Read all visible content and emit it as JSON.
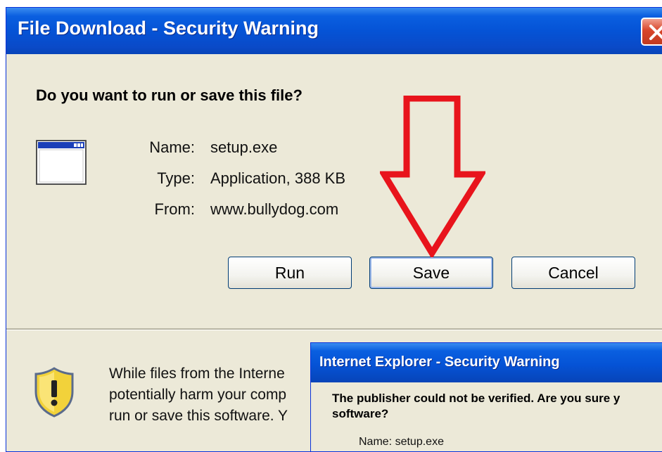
{
  "dialog": {
    "title": "File Download - Security Warning",
    "question": "Do you want to run or save this file?",
    "file": {
      "name_label": "Name:",
      "name_value": "setup.exe",
      "type_label": "Type:",
      "type_value": "Application, 388 KB",
      "from_label": "From:",
      "from_value": "www.bullydog.com"
    },
    "buttons": {
      "run": "Run",
      "save": "Save",
      "cancel": "Cancel"
    },
    "warning_lines": [
      "While files from the Interne",
      "potentially harm your comp",
      "run or save this software. Y"
    ]
  },
  "ie_dialog": {
    "title": "Internet Explorer - Security Warning",
    "message_line1": "The publisher could not be verified.  Are you sure y",
    "message_line2": "software?",
    "name_label": "Name:",
    "name_value": "setup.exe"
  },
  "colors": {
    "titlebar": "#0553d6",
    "dialog_bg": "#ece9d8",
    "close_button": "#d8452a",
    "annotation_arrow": "#e8141c"
  },
  "icons": {
    "app": "application-window-icon",
    "shield": "shield-warning-icon",
    "close": "close-icon",
    "annotation": "red-arrow-annotation"
  }
}
